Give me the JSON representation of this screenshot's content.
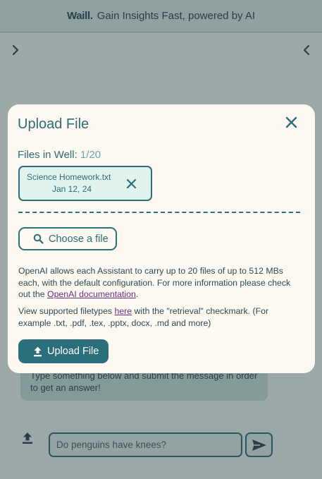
{
  "header": {
    "brand": "Waill.",
    "tagline": "Gain Insights Fast, powered by AI"
  },
  "chat": {
    "message_text": "Type something below and submit the message in order to get an answer!",
    "input_placeholder": "Do penguins have knees?"
  },
  "modal": {
    "title": "Upload File",
    "files_label": "Files in Well: ",
    "files_count": "1/20",
    "file": {
      "name": "Science Homework.txt",
      "date": "Jan 12, 24"
    },
    "choose_label": "Choose a file",
    "info_1_text": "OpenAI allows each Assistant to carry up to 20 files of up to 512 MBs each, with the default configuration. For more information please check out the ",
    "info_1_link": "OpenAI documentation",
    "info_1_end": ".",
    "info_2_text": "View supported filetypes ",
    "info_2_link": "here",
    "info_2_end": " with the \"retrieval\" checkmark. (For example .txt, .pdf, .tex, .pptx, docx, .md and more)",
    "upload_label": "Upload File"
  },
  "colors": {
    "accent": "#2b6f7d",
    "modal_bg": "#fdf8f0",
    "header_bg": "#cfe6e0",
    "link": "#6b2c8a"
  },
  "icons": {
    "expand_left": "chevron-right-icon",
    "expand_right": "chevron-left-icon",
    "close": "close-icon",
    "remove_file": "close-icon",
    "choose": "search-icon",
    "upload": "upload-icon",
    "send": "send-icon"
  }
}
